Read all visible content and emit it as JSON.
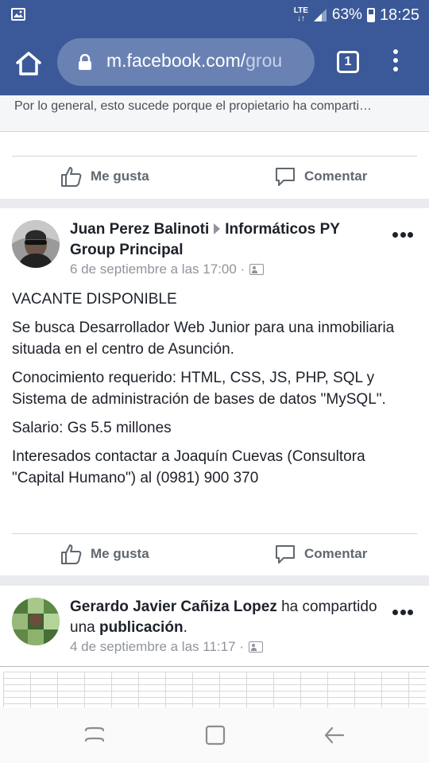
{
  "status_bar": {
    "network": "LTE",
    "battery": "63%",
    "time": "18:25"
  },
  "browser": {
    "url_main": "m.facebook.com/",
    "url_dim": "grou",
    "tab_count": "1"
  },
  "notice": {
    "text": "Por lo general, esto sucede porque el propietario ha comparti…"
  },
  "actions": {
    "like": "Me gusta",
    "comment": "Comentar"
  },
  "post1": {
    "author": "Juan Perez Balinoti",
    "group": "Informáticos PY Group Principal",
    "timestamp": "6 de septiembre a las 17:00 ·",
    "paragraphs": [
      "VACANTE DISPONIBLE",
      "Se busca Desarrollador Web Junior para una inmobiliaria situada en el centro de Asunción.",
      "Conocimiento requerido: HTML, CSS, JS, PHP, SQL y Sistema de administración de bases de datos \"MySQL\".",
      "Salario: Gs 5.5 millones",
      "Interesados contactar a Joaquín Cuevas (Consultora \"Capital Humano\") al (0981) 900 370"
    ]
  },
  "post2": {
    "author": "Gerardo Javier Cañiza Lopez",
    "verb": " ha compartido una ",
    "object": "publicación",
    "end": ".",
    "timestamp": "4 de septiembre a las 11:17 ·"
  },
  "colors": {
    "facebook_blue": "#3b5998",
    "url_pill": "#6a81b3",
    "muted_text": "#90949c",
    "action_text": "#606770"
  },
  "icons": [
    "image-icon",
    "signal-icon",
    "battery-icon",
    "home-icon",
    "lock-icon",
    "tabs-icon",
    "more-vert-icon",
    "like-icon",
    "comment-icon",
    "audience-icon",
    "more-horiz-icon",
    "recents-icon",
    "overview-icon",
    "back-icon"
  ]
}
